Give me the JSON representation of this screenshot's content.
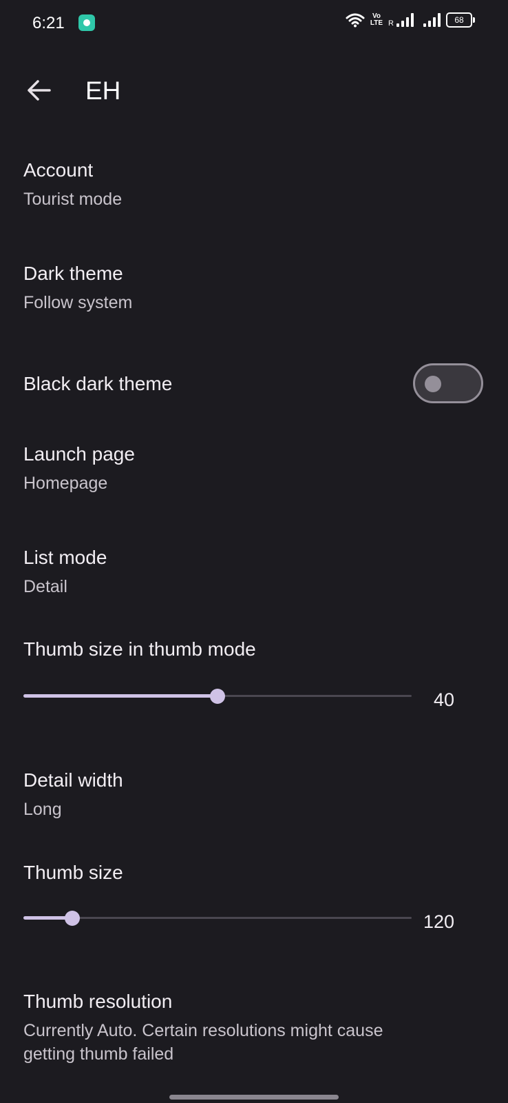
{
  "status_bar": {
    "time": "6:21",
    "volte_top": "Vo",
    "volte_bottom": "LTE",
    "roaming": "R",
    "battery": "68"
  },
  "header": {
    "title": "EH"
  },
  "prefs": {
    "account": {
      "title": "Account",
      "summary": "Tourist mode"
    },
    "dark_theme": {
      "title": "Dark theme",
      "summary": "Follow system"
    },
    "black_dark_theme": {
      "title": "Black dark theme",
      "enabled": false
    },
    "launch_page": {
      "title": "Launch page",
      "summary": "Homepage"
    },
    "list_mode": {
      "title": "List mode",
      "summary": "Detail"
    },
    "thumb_size_thumb_mode": {
      "title": "Thumb size in thumb mode",
      "value": "40",
      "fraction": 0.5
    },
    "detail_width": {
      "title": "Detail width",
      "summary": "Long"
    },
    "thumb_size": {
      "title": "Thumb size",
      "value": "120",
      "fraction": 0.125
    },
    "thumb_resolution": {
      "title": "Thumb resolution",
      "summary_line1": "Currently Auto. Certain resolutions might cause",
      "summary_line2": "getting thumb failed"
    }
  },
  "colors": {
    "background": "#1c1b20",
    "accent": "#cfc2e6",
    "switch_outline": "#948f99"
  }
}
